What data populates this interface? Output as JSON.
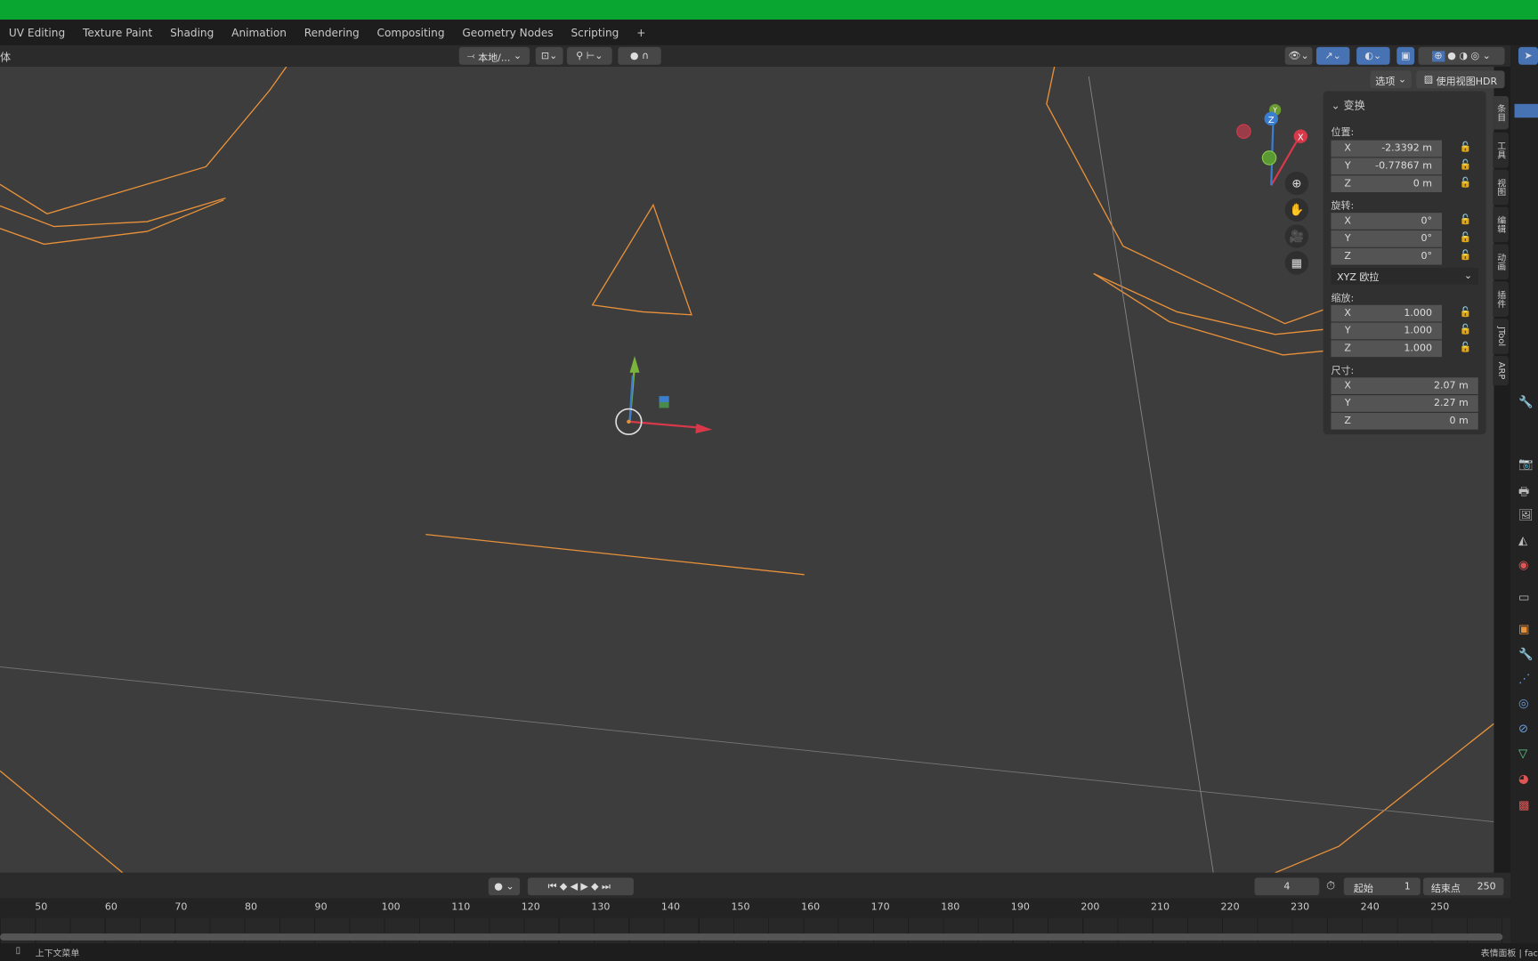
{
  "workspace_tabs": [
    "UV Editing",
    "Texture Paint",
    "Shading",
    "Animation",
    "Rendering",
    "Compositing",
    "Geometry Nodes",
    "Scripting",
    "+"
  ],
  "header": {
    "mode_fragment": "体",
    "transform_orientation": "本地/...",
    "options_label": "选项",
    "hdr_label": "使用视图HDR"
  },
  "n_panel": {
    "title": "变换",
    "location_label": "位置:",
    "location": [
      {
        "axis": "X",
        "value": "-2.3392 m"
      },
      {
        "axis": "Y",
        "value": "-0.77867 m"
      },
      {
        "axis": "Z",
        "value": "0 m"
      }
    ],
    "rotation_label": "旋转:",
    "rotation": [
      {
        "axis": "X",
        "value": "0°"
      },
      {
        "axis": "Y",
        "value": "0°"
      },
      {
        "axis": "Z",
        "value": "0°"
      }
    ],
    "rotation_mode": "XYZ 欧拉",
    "scale_label": "缩放:",
    "scale": [
      {
        "axis": "X",
        "value": "1.000"
      },
      {
        "axis": "Y",
        "value": "1.000"
      },
      {
        "axis": "Z",
        "value": "1.000"
      }
    ],
    "dimensions_label": "尺寸:",
    "dimensions": [
      {
        "axis": "X",
        "value": "2.07 m"
      },
      {
        "axis": "Y",
        "value": "2.27 m"
      },
      {
        "axis": "Z",
        "value": "0 m"
      }
    ]
  },
  "sidebar_tabs": [
    "条目",
    "工具",
    "视图",
    "编辑",
    "动画",
    "插件",
    "JTool",
    "ARP"
  ],
  "gizmo": {
    "x": "X",
    "y": "Y",
    "z": "Z"
  },
  "timeline": {
    "current_frame": "4",
    "start_label": "起始",
    "start": "1",
    "end_label": "结束点",
    "end": "250",
    "ticks": [
      "50",
      "60",
      "70",
      "80",
      "90",
      "100",
      "110",
      "120",
      "130",
      "140",
      "150",
      "160",
      "170",
      "180",
      "190",
      "200",
      "210",
      "220",
      "230",
      "240",
      "250"
    ]
  },
  "status": {
    "left": "上下文菜单",
    "right": "表情面板 | fac"
  },
  "colors": {
    "accent": "#4772b3",
    "selection": "#e8913a",
    "title_bar": "#0aa632"
  }
}
